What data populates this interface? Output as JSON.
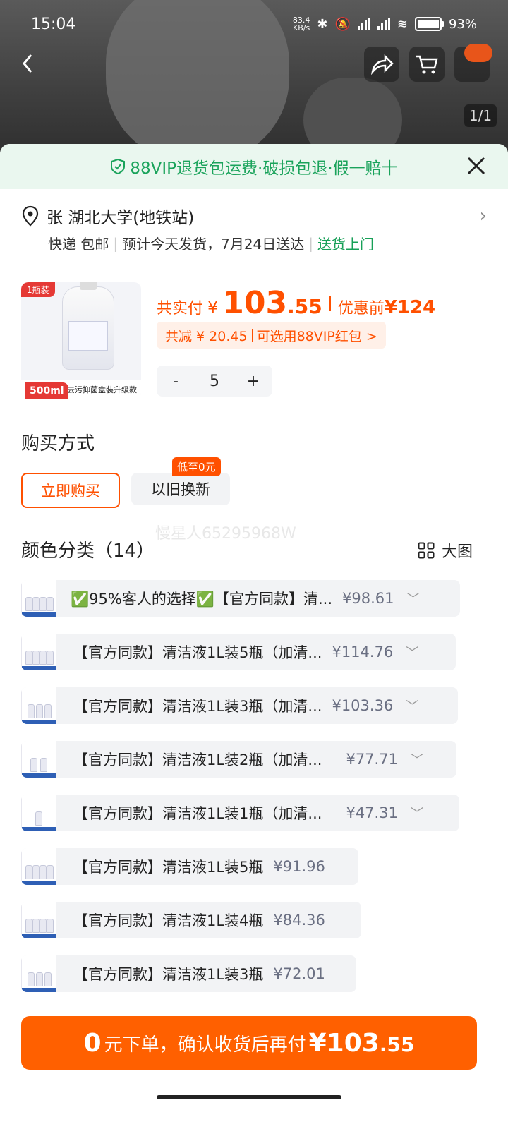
{
  "status": {
    "time": "15:04",
    "net_speed": "83.4\nKB/s",
    "battery": "93%"
  },
  "hero": {
    "pager": "1/1"
  },
  "vip": {
    "text": "88VIP退货包运费·破损包退·假一赔十"
  },
  "address": {
    "name_addr": "张 湖北大学(地铁站)",
    "express": "快递 包邮",
    "ship": "预计今天发货，7月24日送达",
    "door": "送货上门"
  },
  "product": {
    "tag": "1瓶装",
    "ml": "500ml",
    "band": "去污抑菌盒装升级款",
    "paid_label": "共实付",
    "currency": "¥",
    "price_int": "103",
    "price_dec": ".55",
    "before_label": "优惠前",
    "before_value": "¥124",
    "reduce": "共减 ¥ 20.45",
    "redpack": "可选用88VIP红包 >",
    "qty_minus": "-",
    "qty": "5",
    "qty_plus": "+"
  },
  "purchase": {
    "title": "购买方式",
    "buy_now": "立即购买",
    "trade_in": "以旧换新",
    "low_badge": "低至0元"
  },
  "watermark": "慢星人65295968W",
  "colors": {
    "title": "颜色分类（14）",
    "big_view": "大图",
    "options": [
      {
        "name": "✅95%客人的选择✅【官方同款】清...",
        "price": "¥98.61",
        "expand": true
      },
      {
        "name": "【官方同款】清洁液1L装5瓶（加清...",
        "price": "¥114.76",
        "expand": true
      },
      {
        "name": "【官方同款】清洁液1L装3瓶（加清...",
        "price": "¥103.36",
        "expand": true
      },
      {
        "name": "【官方同款】清洁液1L装2瓶（加清...",
        "price": "¥77.71",
        "expand": true
      },
      {
        "name": "【官方同款】清洁液1L装1瓶（加清...",
        "price": "¥47.31",
        "expand": true
      },
      {
        "name": "【官方同款】清洁液1L装5瓶",
        "price": "¥91.96",
        "expand": false
      },
      {
        "name": "【官方同款】清洁液1L装4瓶",
        "price": "¥84.36",
        "expand": false
      },
      {
        "name": "【官方同款】清洁液1L装3瓶",
        "price": "¥72.01",
        "expand": false
      }
    ]
  },
  "cta": {
    "zero": "0",
    "text": "元下单，确认收货后再付",
    "amount_int": "¥103",
    "amount_dec": ".55"
  },
  "accent": "#ff5000"
}
